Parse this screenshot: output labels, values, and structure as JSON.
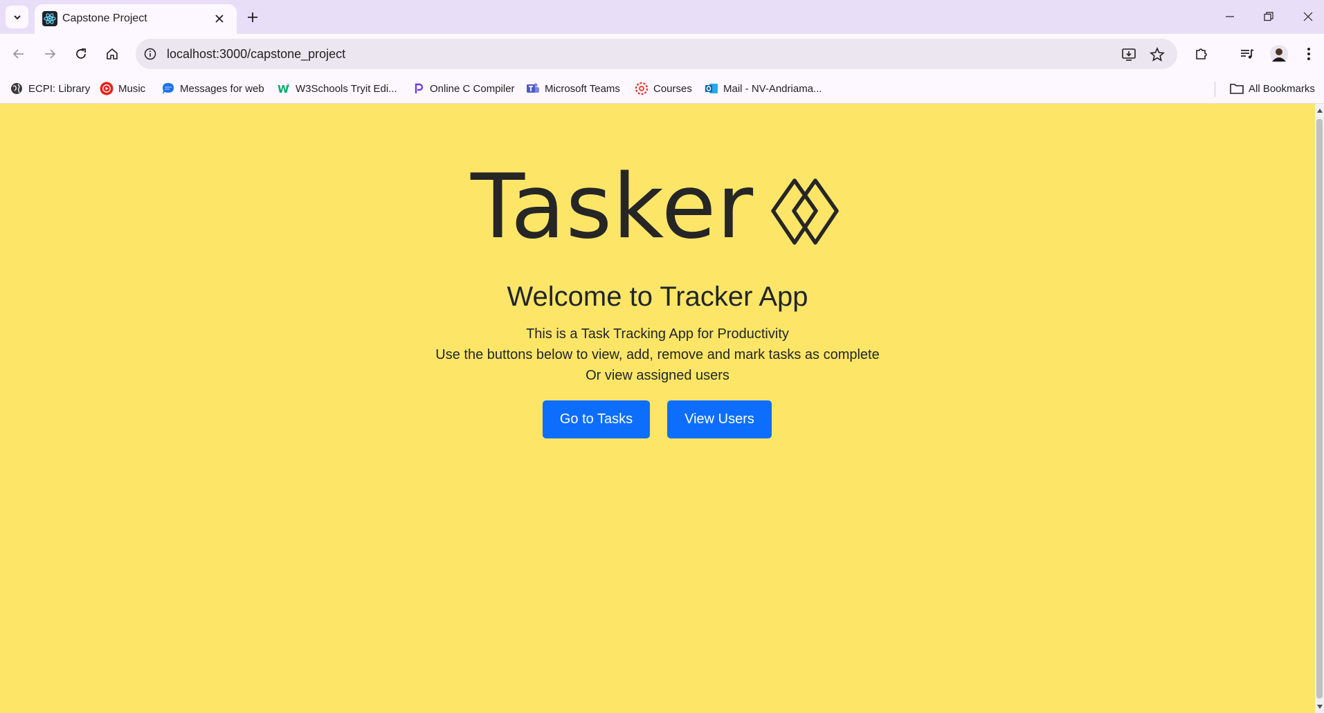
{
  "browser": {
    "tab": {
      "title": "Capstone Project"
    },
    "url": "localhost:3000/capstone_project",
    "bookmarks": [
      {
        "label": "ECPI: Library",
        "icon": "globe-icon"
      },
      {
        "label": "Music",
        "icon": "youtube-music-icon"
      },
      {
        "label": "Messages for web",
        "icon": "messages-icon"
      },
      {
        "label": "W3Schools Tryit Edi...",
        "icon": "w3schools-icon"
      },
      {
        "label": "Online C Compiler",
        "icon": "compiler-icon"
      },
      {
        "label": "Microsoft Teams",
        "icon": "teams-icon"
      },
      {
        "label": "Courses",
        "icon": "courses-icon"
      },
      {
        "label": "Mail - NV-Andriama...",
        "icon": "outlook-icon"
      }
    ],
    "all_bookmarks": "All Bookmarks"
  },
  "page": {
    "logo_text": "Tasker",
    "welcome": "Welcome to Tracker App",
    "lines": [
      "This is a Task Tracking App for Productivity",
      "Use the buttons below to view, add, remove and mark tasks as complete",
      "Or view assigned users"
    ],
    "buttons": {
      "tasks": "Go to Tasks",
      "users": "View Users"
    }
  },
  "colors": {
    "page_background": "#fde667",
    "button": "#0d6efd",
    "tabstrip": "#e8def8"
  }
}
